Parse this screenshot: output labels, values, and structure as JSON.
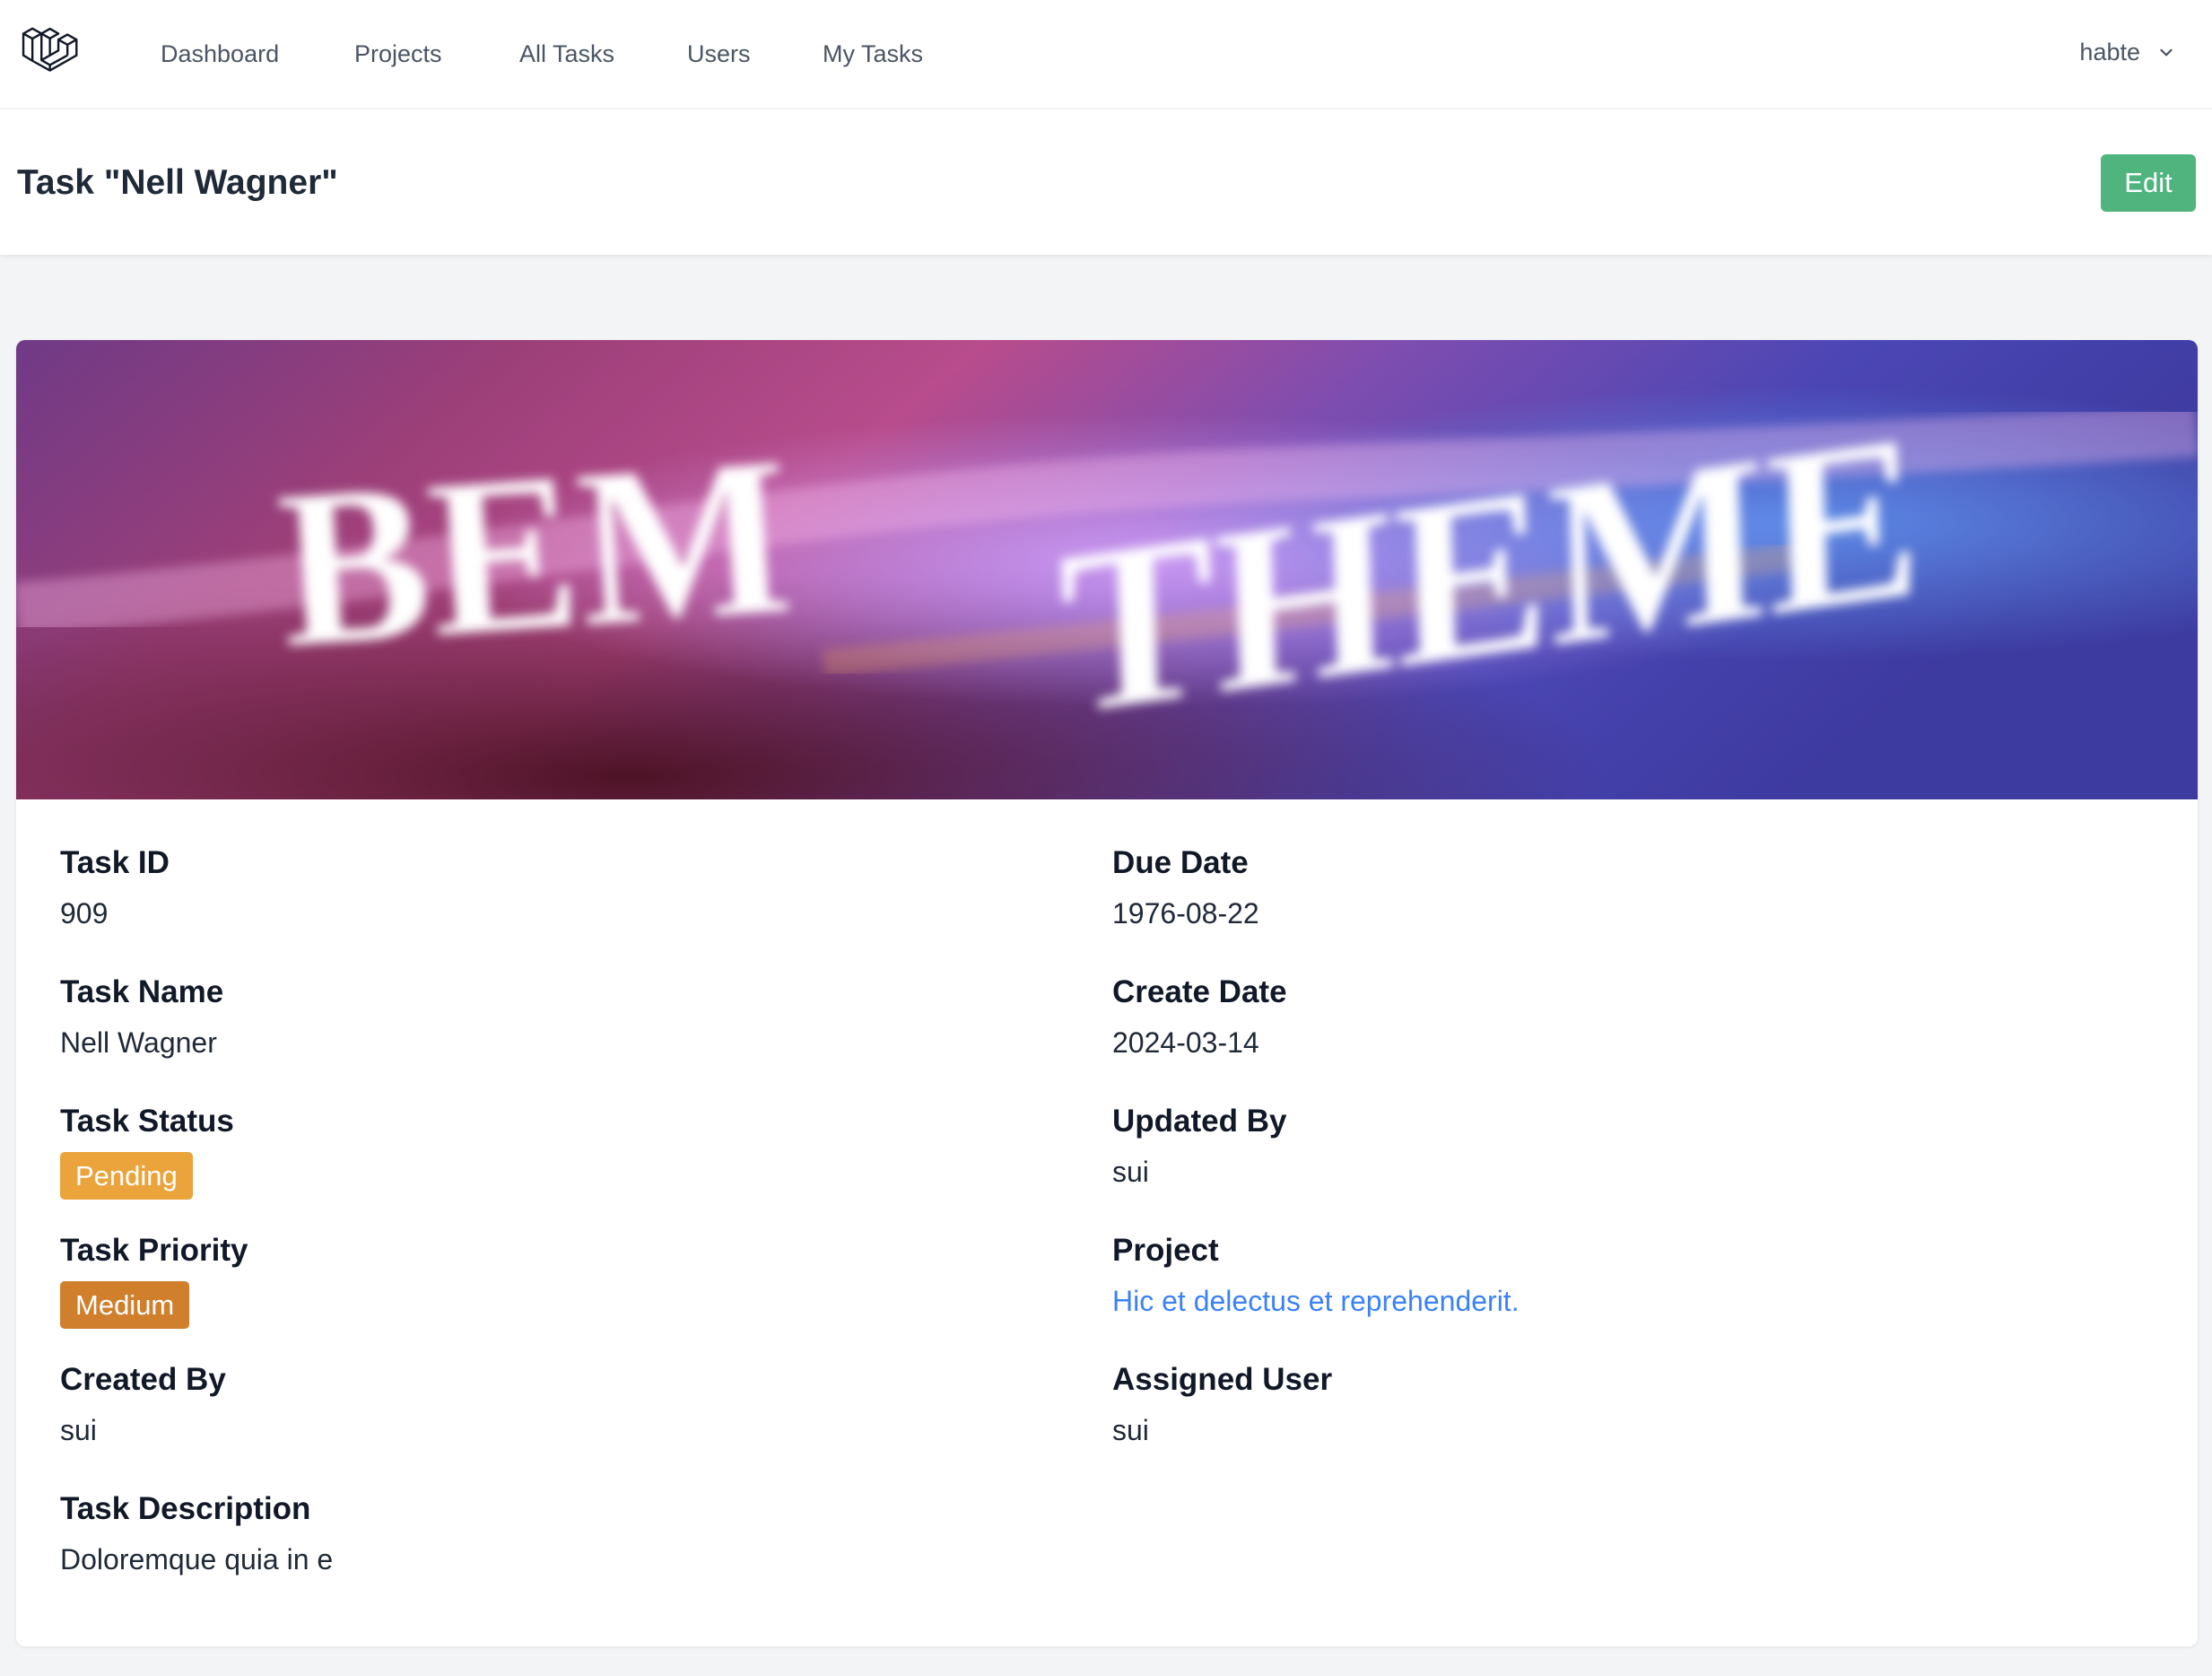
{
  "nav": {
    "items": [
      {
        "label": "Dashboard"
      },
      {
        "label": "Projects"
      },
      {
        "label": "All Tasks"
      },
      {
        "label": "Users"
      },
      {
        "label": "My Tasks"
      }
    ],
    "user_name": "habte",
    "user_menu_icon": "chevron-down-icon",
    "logo_icon": "laravel-logo-icon"
  },
  "header": {
    "title": "Task \"Nell Wagner\"",
    "edit_label": "Edit",
    "edit_color": "#4fb47e"
  },
  "banner": {
    "text_line_1": "BEM",
    "text_line_2": "THEME"
  },
  "task": {
    "id_label": "Task ID",
    "id_value": "909",
    "name_label": "Task Name",
    "name_value": "Nell Wagner",
    "status_label": "Task Status",
    "status_value": "Pending",
    "status_color": "#eba43b",
    "priority_label": "Task Priority",
    "priority_value": "Medium",
    "priority_color": "#d07f2c",
    "created_by_label": "Created By",
    "created_by_value": "sui",
    "description_label": "Task Description",
    "description_value": "Doloremque quia in e",
    "due_date_label": "Due Date",
    "due_date_value": "1976-08-22",
    "create_date_label": "Create Date",
    "create_date_value": "2024-03-14",
    "updated_by_label": "Updated By",
    "updated_by_value": "sui",
    "project_label": "Project",
    "project_value": "Hic et delectus et reprehenderit.",
    "project_link_color": "#3b82f6",
    "assigned_user_label": "Assigned User",
    "assigned_user_value": "sui"
  }
}
